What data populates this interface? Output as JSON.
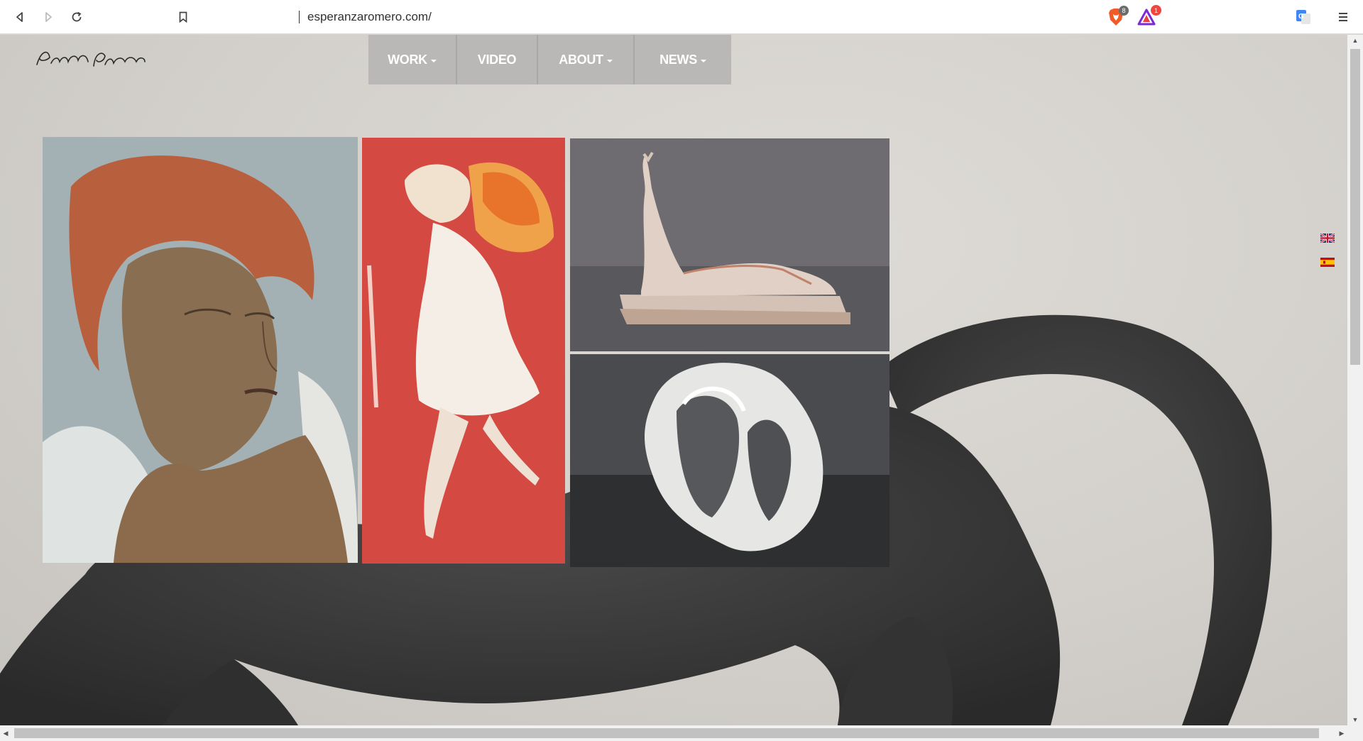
{
  "browser": {
    "url": "esperanzaromero.com/",
    "brave_shield_count": "8",
    "rewards_count": "1"
  },
  "site": {
    "logo_text": "Esperanza Romero",
    "nav": [
      {
        "label": "WORK",
        "dropdown": true
      },
      {
        "label": "VIDEO",
        "dropdown": false
      },
      {
        "label": "ABOUT",
        "dropdown": true
      },
      {
        "label": "NEWS",
        "dropdown": true
      }
    ],
    "languages": [
      "english-flag-icon",
      "spanish-flag-icon"
    ]
  },
  "colors": {
    "nav_bg": "#b9b8b6",
    "accent_red": "#d7403a"
  }
}
